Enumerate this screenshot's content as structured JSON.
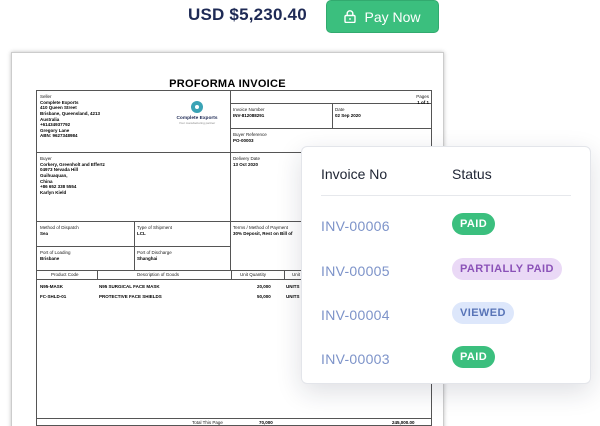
{
  "payment": {
    "amount": "USD $5,230.40",
    "pay_label": "Pay Now",
    "button_color": "#3bbf7e"
  },
  "invoice_doc": {
    "title": "PROFORMA INVOICE",
    "seller_label": "Seller",
    "seller_lines": [
      "Complete Exports",
      "410 Queen Street",
      "Brisbane, Queensland, 4213",
      "Australia",
      "+61434937792",
      "Gregory Lane",
      "ABN: 9627348984"
    ],
    "logo_name": "Complete Exports",
    "logo_sub": "Your manufacturing partner",
    "pages_label": "Pages",
    "pages_value": "1 of 1",
    "invoice_number_label": "Invoice Number",
    "invoice_number_value": "INV-812088291",
    "date_label": "Date",
    "date_value": "02 Sep 2020",
    "buyer_reference_label": "Buyer Reference",
    "buyer_reference_value": "PO-00003",
    "buyer_label": "Buyer",
    "buyer_lines": [
      "Corkery, Greenholt and Effertz",
      "04973 Nevada Hill",
      "Guihuaquan,",
      "China",
      "+86 652 338 5554",
      "Karlyn Kield"
    ],
    "delivery_date_label": "Delivery Date",
    "delivery_date_value": "13 Oct 2020",
    "method_dispatch_label": "Method of Dispatch",
    "method_dispatch_value": "Sea",
    "type_shipment_label": "Type of Shipment",
    "type_shipment_value": "LCL",
    "terms_label": "Terms / Method of Payment",
    "terms_value": "30% Deposit, Rest on Bill of",
    "port_loading_label": "Port of Loading",
    "port_loading_value": "Brisbane",
    "port_discharge_label": "Port of Discharge",
    "port_discharge_value": "Shanghai",
    "columns": [
      "Product Code",
      "Description of Goods",
      "Unit Quantity",
      "Unit"
    ],
    "rows": [
      {
        "code": "N95-MASK",
        "desc": "N95 SURGICAL FACE MASK",
        "qty": "20,000",
        "unit": "UNITS"
      },
      {
        "code": "FC-SHLD-01",
        "desc": "PROTECTIVE FACE SHIELDS",
        "qty": "50,000",
        "unit": "UNITS"
      }
    ],
    "total_label": "Total This Page",
    "total_qty": "70,000",
    "total_amount": "245,000.00"
  },
  "status_card": {
    "col_invoice": "Invoice No",
    "col_status": "Status",
    "rows": [
      {
        "invoice": "INV-00006",
        "status": "PAID",
        "kind": "paid"
      },
      {
        "invoice": "INV-00005",
        "status": "PARTIALLY PAID",
        "kind": "partial"
      },
      {
        "invoice": "INV-00004",
        "status": "VIEWED",
        "kind": "viewed"
      },
      {
        "invoice": "INV-00003",
        "status": "PAID",
        "kind": "paid"
      }
    ],
    "colors": {
      "paid": "#3bbf7e",
      "partial": "#ead9f6",
      "viewed": "#dde7fb"
    }
  }
}
